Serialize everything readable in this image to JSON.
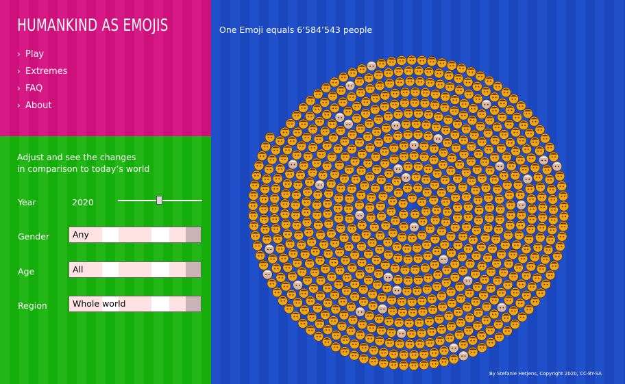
{
  "app_title": "HUMANKIND AS EMOJIS",
  "nav": [
    "Play",
    "Extremes",
    "FAQ",
    "About"
  ],
  "intro": [
    "Adjust and see the changes",
    "in comparison to today’s world"
  ],
  "controls": {
    "year_label": "Year",
    "year_value": "2020",
    "gender_label": "Gender",
    "gender_value": "Any",
    "age_label": "Age",
    "age_value": "All",
    "region_label": "Region",
    "region_value": "Whole world"
  },
  "subtitle": "One Emoji equals 6’584’543 people",
  "footer": "By Stefanie Hetjens, Copyright 2020, CC-BY-SA",
  "colors": {
    "pink_panel": "#d4107f",
    "green_panel": "#16b30a",
    "blue_panel": "#1f4fc9",
    "emoji_face": "#f2a60f"
  },
  "emoji_icon": "person-face-emoji"
}
